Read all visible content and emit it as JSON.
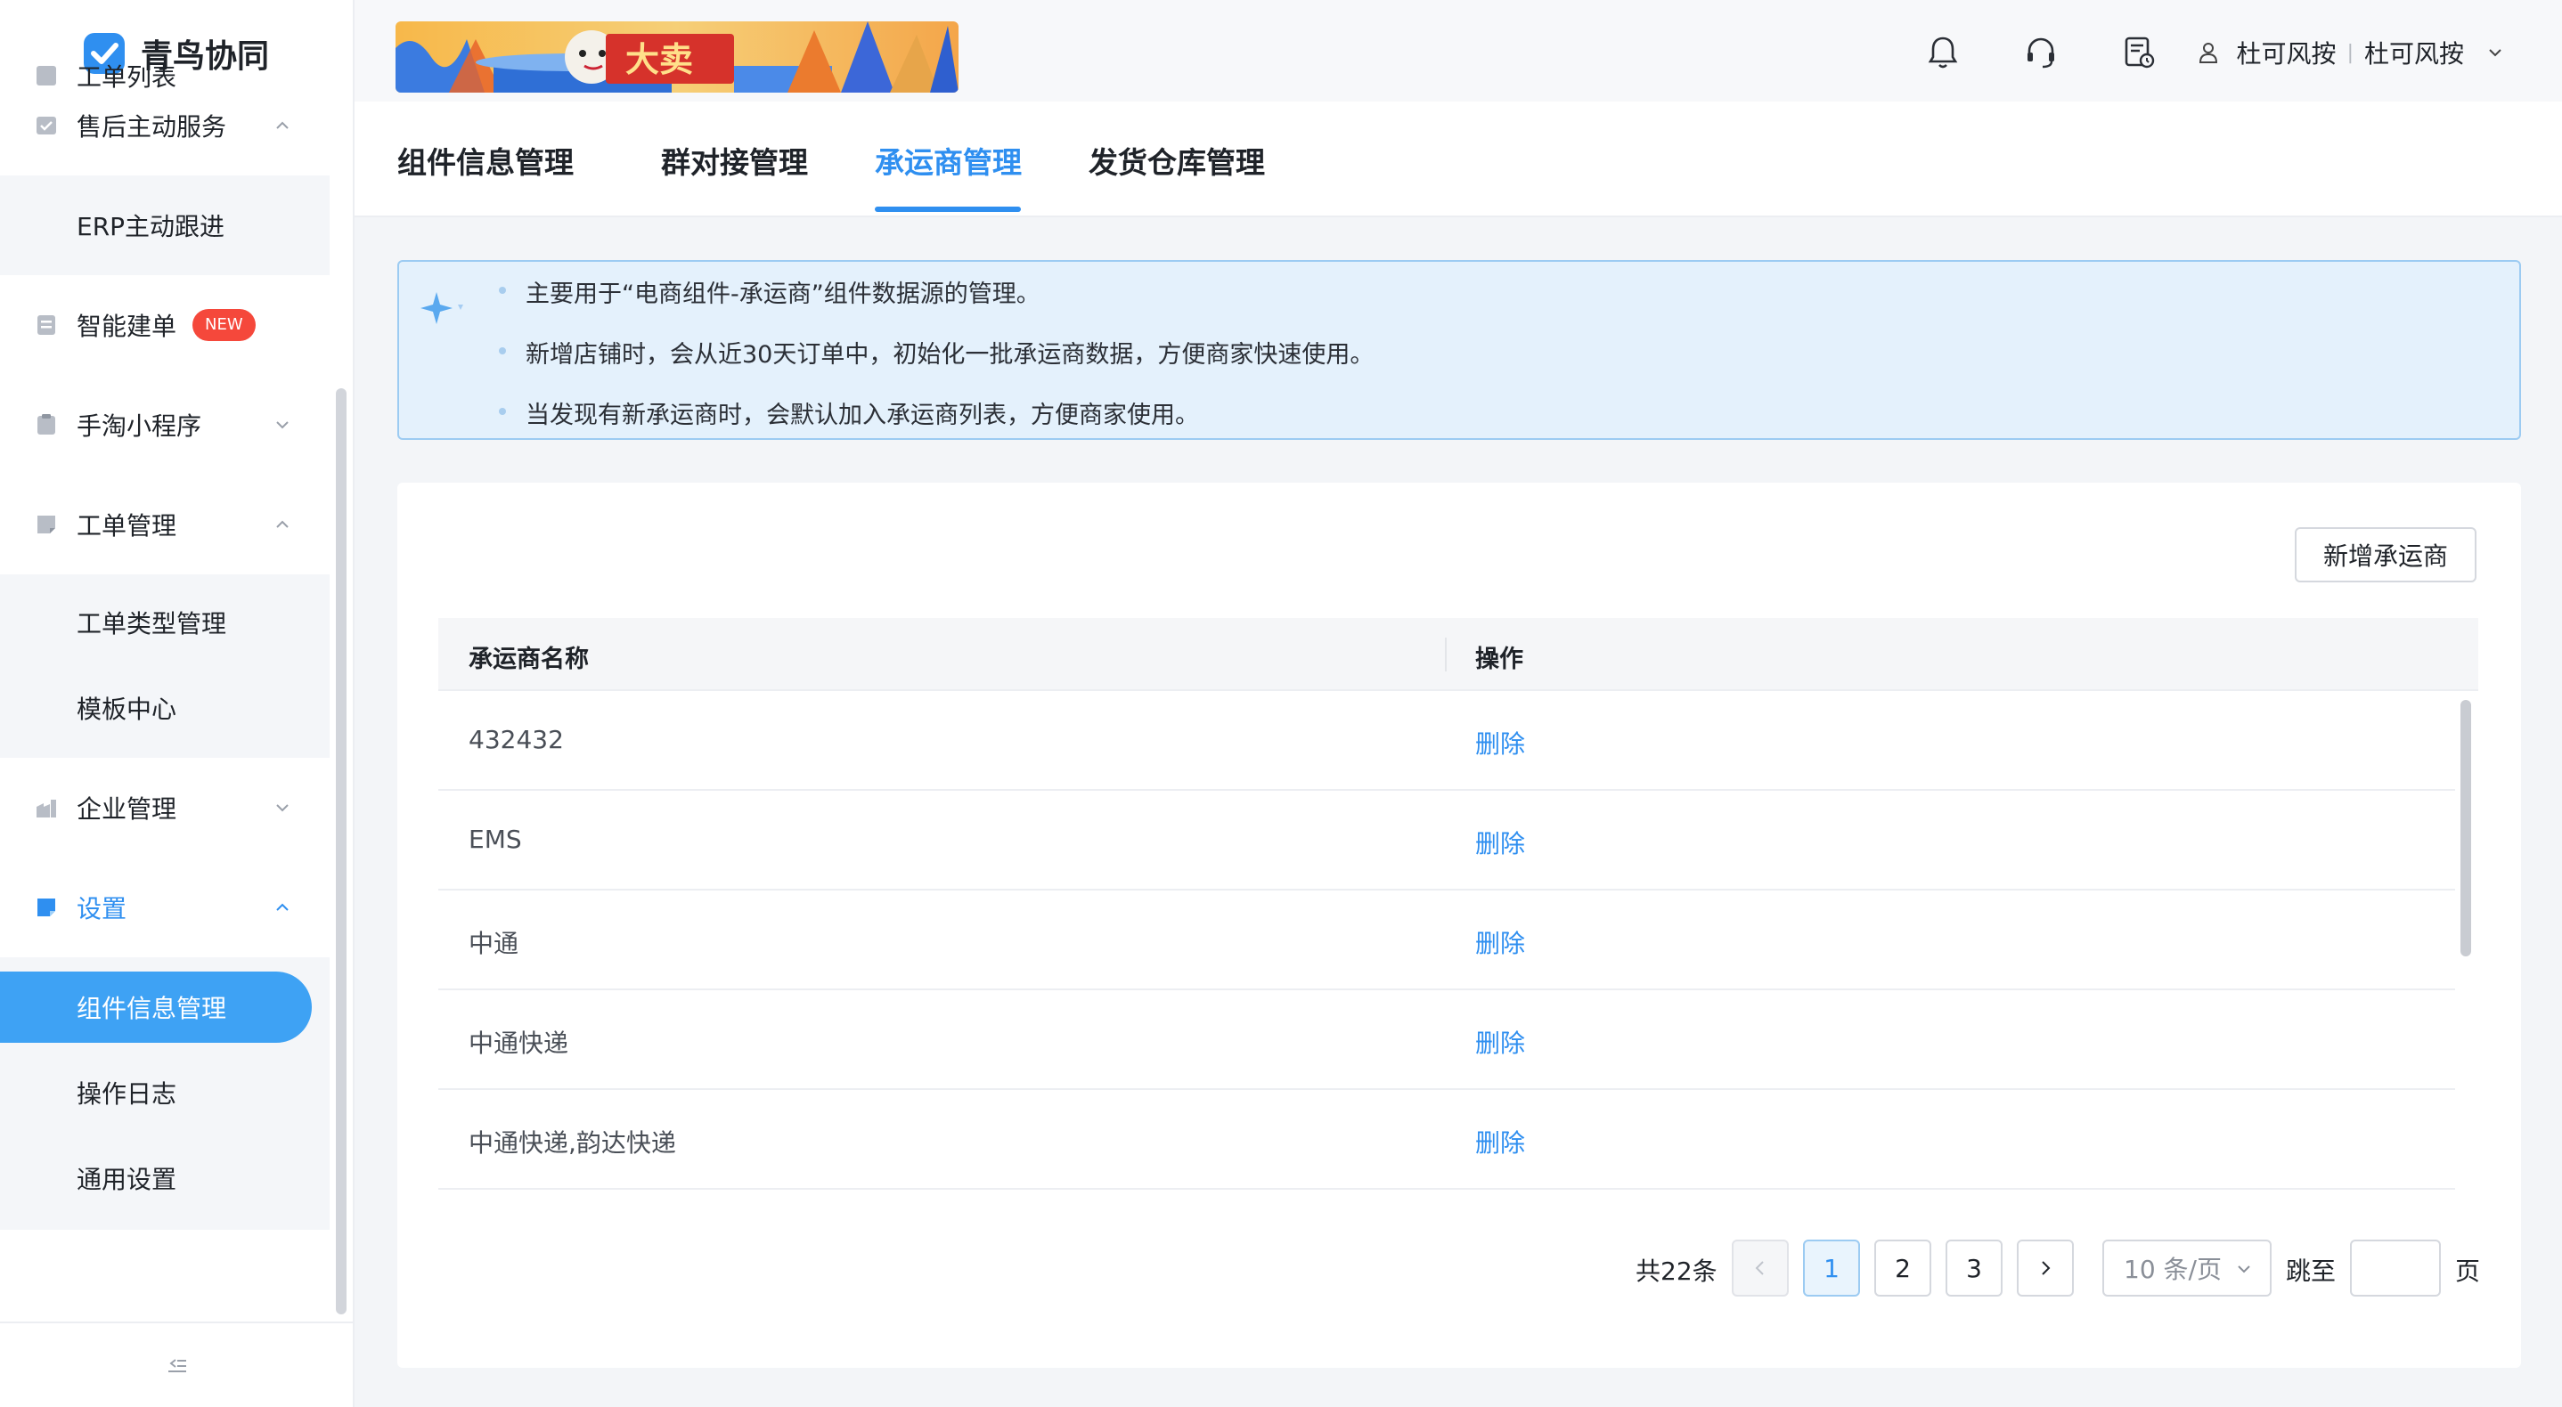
{
  "brand": {
    "name": "青鸟协同",
    "accent": "#2f8ff0"
  },
  "sidebar": {
    "peek_item": "工单列表",
    "items": [
      {
        "label": "售后主动服务",
        "icon": "checklist-icon"
      },
      {
        "label": "ERP主动跟进"
      },
      {
        "label": "智能建单",
        "badge": "NEW",
        "icon": "document-icon"
      },
      {
        "label": "手淘小程序",
        "icon": "clipboard-icon"
      },
      {
        "label": "工单管理",
        "icon": "ticket-icon"
      },
      {
        "label": "工单类型管理"
      },
      {
        "label": "模板中心"
      },
      {
        "label": "企业管理",
        "icon": "building-icon"
      },
      {
        "label": "设置",
        "icon": "settings-icon"
      },
      {
        "label": "组件信息管理"
      },
      {
        "label": "操作日志"
      },
      {
        "label": "通用设置"
      }
    ]
  },
  "header": {
    "banner_text": "大卖",
    "user": {
      "name": "杜可风按",
      "org": "杜可风按"
    }
  },
  "tabs": [
    {
      "label": "组件信息管理"
    },
    {
      "label": "群对接管理"
    },
    {
      "label": "承运商管理",
      "active": true
    },
    {
      "label": "发货仓库管理"
    }
  ],
  "alert": {
    "lines": [
      "主要用于“电商组件-承运商”组件数据源的管理。",
      "新增店铺时，会从近30天订单中，初始化一批承运商数据，方便商家快速使用。",
      "当发现有新承运商时，会默认加入承运商列表，方便商家使用。"
    ]
  },
  "toolbar": {
    "add_label": "新增承运商"
  },
  "table": {
    "columns": [
      "承运商名称",
      "操作"
    ],
    "rows": [
      {
        "name": "432432",
        "action": "删除"
      },
      {
        "name": "EMS",
        "action": "删除"
      },
      {
        "name": "中通",
        "action": "删除"
      },
      {
        "name": "中通快递",
        "action": "删除"
      },
      {
        "name": "中通快递,韵达快递",
        "action": "删除"
      }
    ]
  },
  "pagination": {
    "total_label": "共22条",
    "pages": [
      "1",
      "2",
      "3"
    ],
    "current_page": "1",
    "page_size": "10 条/页",
    "jump_label": "跳至",
    "jump_value": "",
    "page_suffix": "页"
  }
}
